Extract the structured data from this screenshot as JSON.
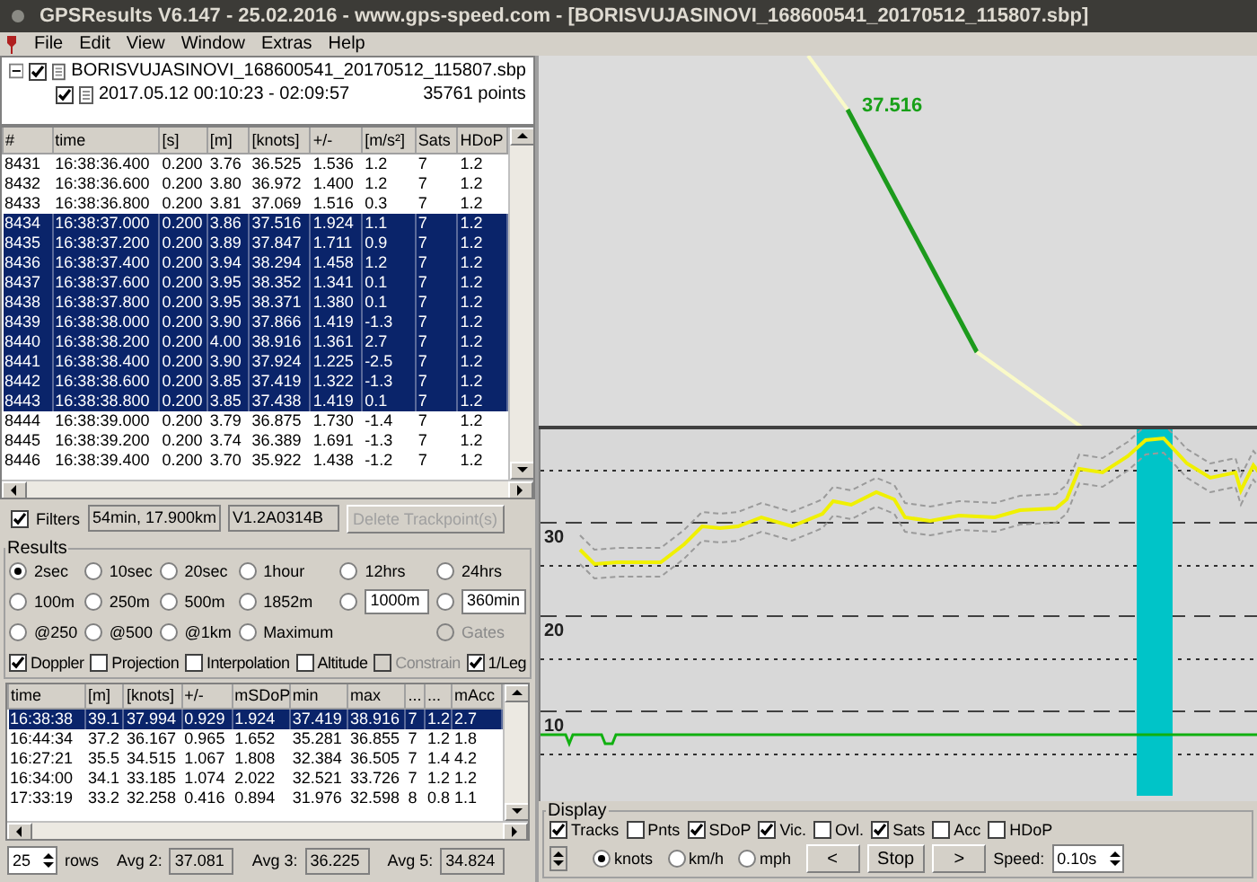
{
  "window": {
    "title": "GPSResults V6.147 - 25.02.2016 - www.gps-speed.com - [BORISVUJASINOVI_168600541_20170512_115807.sbp]"
  },
  "menu": [
    "File",
    "Edit",
    "View",
    "Window",
    "Extras",
    "Help"
  ],
  "tree": {
    "file": {
      "label": "BORISVUJASINOVI_168600541_20170512_115807.sbp",
      "checked": true,
      "expanded": true,
      "children": [
        {
          "label": "2017.05.12 00:10:23 - 02:09:57",
          "points": "35761 points",
          "checked": true
        }
      ]
    }
  },
  "points_table": {
    "columns": [
      "#",
      "time",
      "[s]",
      "[m]",
      "[knots]",
      "+/-",
      "[m/s²]",
      "Sats",
      "HDoP"
    ],
    "rows": [
      {
        "selected": false,
        "cells": [
          "8431",
          "16:38:36.400",
          "0.200",
          "3.76",
          "36.525",
          "1.536",
          "1.2",
          "7",
          "1.2"
        ]
      },
      {
        "selected": false,
        "cells": [
          "8432",
          "16:38:36.600",
          "0.200",
          "3.80",
          "36.972",
          "1.400",
          "1.2",
          "7",
          "1.2"
        ]
      },
      {
        "selected": false,
        "cells": [
          "8433",
          "16:38:36.800",
          "0.200",
          "3.81",
          "37.069",
          "1.516",
          "0.3",
          "7",
          "1.2"
        ]
      },
      {
        "selected": true,
        "cells": [
          "8434",
          "16:38:37.000",
          "0.200",
          "3.86",
          "37.516",
          "1.924",
          "1.1",
          "7",
          "1.2"
        ]
      },
      {
        "selected": true,
        "cells": [
          "8435",
          "16:38:37.200",
          "0.200",
          "3.89",
          "37.847",
          "1.711",
          "0.9",
          "7",
          "1.2"
        ]
      },
      {
        "selected": true,
        "cells": [
          "8436",
          "16:38:37.400",
          "0.200",
          "3.94",
          "38.294",
          "1.458",
          "1.2",
          "7",
          "1.2"
        ]
      },
      {
        "selected": true,
        "cells": [
          "8437",
          "16:38:37.600",
          "0.200",
          "3.95",
          "38.352",
          "1.341",
          "0.1",
          "7",
          "1.2"
        ]
      },
      {
        "selected": true,
        "cells": [
          "8438",
          "16:38:37.800",
          "0.200",
          "3.95",
          "38.371",
          "1.380",
          "0.1",
          "7",
          "1.2"
        ]
      },
      {
        "selected": true,
        "cells": [
          "8439",
          "16:38:38.000",
          "0.200",
          "3.90",
          "37.866",
          "1.419",
          "-1.3",
          "7",
          "1.2"
        ]
      },
      {
        "selected": true,
        "cells": [
          "8440",
          "16:38:38.200",
          "0.200",
          "4.00",
          "38.916",
          "1.361",
          "2.7",
          "7",
          "1.2"
        ]
      },
      {
        "selected": true,
        "cells": [
          "8441",
          "16:38:38.400",
          "0.200",
          "3.90",
          "37.924",
          "1.225",
          "-2.5",
          "7",
          "1.2"
        ]
      },
      {
        "selected": true,
        "cells": [
          "8442",
          "16:38:38.600",
          "0.200",
          "3.85",
          "37.419",
          "1.322",
          "-1.3",
          "7",
          "1.2"
        ]
      },
      {
        "selected": true,
        "cells": [
          "8443",
          "16:38:38.800",
          "0.200",
          "3.85",
          "37.438",
          "1.419",
          "0.1",
          "7",
          "1.2"
        ]
      },
      {
        "selected": false,
        "cells": [
          "8444",
          "16:38:39.000",
          "0.200",
          "3.79",
          "36.875",
          "1.730",
          "-1.4",
          "7",
          "1.2"
        ]
      },
      {
        "selected": false,
        "cells": [
          "8445",
          "16:38:39.200",
          "0.200",
          "3.74",
          "36.389",
          "1.691",
          "-1.3",
          "7",
          "1.2"
        ]
      },
      {
        "selected": false,
        "cells": [
          "8446",
          "16:38:39.400",
          "0.200",
          "3.70",
          "35.922",
          "1.438",
          "-1.2",
          "7",
          "1.2"
        ]
      }
    ]
  },
  "filters": {
    "label": "Filters",
    "checked": true,
    "summary": "54min, 17.900km",
    "version": "V1.2A0314B",
    "delete_button": {
      "label": "Delete Trackpoint(s)",
      "disabled": true
    }
  },
  "results": {
    "title": "Results",
    "options": [
      {
        "kind": "radio",
        "label": "2sec",
        "selected": true,
        "disabled": false
      },
      {
        "kind": "radio",
        "label": "10sec",
        "selected": false,
        "disabled": false
      },
      {
        "kind": "radio",
        "label": "20sec",
        "selected": false,
        "disabled": false
      },
      {
        "kind": "radio",
        "label": "1hour",
        "selected": false,
        "disabled": false
      },
      {
        "kind": "radio",
        "label": "12hrs",
        "selected": false,
        "disabled": false
      },
      {
        "kind": "radio",
        "label": "24hrs",
        "selected": false,
        "disabled": false
      },
      {
        "kind": "radio",
        "label": "100m",
        "selected": false,
        "disabled": false
      },
      {
        "kind": "radio",
        "label": "250m",
        "selected": false,
        "disabled": false
      },
      {
        "kind": "radio",
        "label": "500m",
        "selected": false,
        "disabled": false
      },
      {
        "kind": "radio",
        "label": "1852m",
        "selected": false,
        "disabled": false
      },
      {
        "kind": "radio_field",
        "value": "1000m",
        "selected": false,
        "disabled": false
      },
      {
        "kind": "radio_field",
        "value": "360min",
        "selected": false,
        "disabled": false
      },
      {
        "kind": "radio",
        "label": "@250",
        "selected": false,
        "disabled": false
      },
      {
        "kind": "radio",
        "label": "@500",
        "selected": false,
        "disabled": false
      },
      {
        "kind": "radio",
        "label": "@1km",
        "selected": false,
        "disabled": false
      },
      {
        "kind": "radio",
        "label": "Maximum",
        "selected": false,
        "disabled": false
      },
      {
        "kind": "spacer"
      },
      {
        "kind": "radio",
        "label": "Gates",
        "selected": false,
        "disabled": true
      }
    ],
    "checks": [
      {
        "label": "Doppler",
        "checked": true,
        "disabled": false
      },
      {
        "label": "Projection",
        "checked": false,
        "disabled": false
      },
      {
        "label": "Interpolation",
        "checked": false,
        "disabled": false
      },
      {
        "label": "Altitude",
        "checked": false,
        "disabled": false
      },
      {
        "label": "Constrain",
        "checked": false,
        "disabled": true
      },
      {
        "label": "1/Leg",
        "checked": true,
        "disabled": false
      }
    ]
  },
  "results_table": {
    "columns": [
      "time",
      "[m]",
      "[knots]",
      "+/-",
      "mSDoP",
      "min",
      "max",
      "...",
      "...",
      "mAcc"
    ],
    "rows": [
      {
        "selected": true,
        "cells": [
          "16:38:38",
          "39.1",
          "37.994",
          "0.929",
          "1.924",
          "37.419",
          "38.916",
          "7",
          "1.2",
          "2.7"
        ]
      },
      {
        "selected": false,
        "cells": [
          "16:44:34",
          "37.2",
          "36.167",
          "0.965",
          "1.652",
          "35.281",
          "36.855",
          "7",
          "1.2",
          "1.8"
        ]
      },
      {
        "selected": false,
        "cells": [
          "16:27:21",
          "35.5",
          "34.515",
          "1.067",
          "1.808",
          "32.384",
          "36.505",
          "7",
          "1.4",
          "4.2"
        ]
      },
      {
        "selected": false,
        "cells": [
          "16:34:00",
          "34.1",
          "33.185",
          "1.074",
          "2.022",
          "32.521",
          "33.726",
          "7",
          "1.2",
          "1.2"
        ]
      },
      {
        "selected": false,
        "cells": [
          "17:33:19",
          "33.2",
          "32.258",
          "0.416",
          "0.894",
          "31.976",
          "32.598",
          "8",
          "0.8",
          "1.1"
        ]
      }
    ]
  },
  "footer": {
    "rows_value": "25",
    "rows_label": "rows",
    "averages": [
      {
        "label": "Avg 2:",
        "value": "37.081"
      },
      {
        "label": "Avg 3:",
        "value": "36.225"
      },
      {
        "label": "Avg 5:",
        "value": "34.824"
      }
    ]
  },
  "map": {
    "speed_label": "37.516"
  },
  "speed_graph": {
    "y_labels": [
      "30",
      "20",
      "10"
    ]
  },
  "display": {
    "title": "Display",
    "checks": [
      {
        "label": "Tracks",
        "checked": true
      },
      {
        "label": "Pnts",
        "checked": false
      },
      {
        "label": "SDoP",
        "checked": true
      },
      {
        "label": "Vic.",
        "checked": true
      },
      {
        "label": "Ovl.",
        "checked": false
      },
      {
        "label": "Sats",
        "checked": true
      },
      {
        "label": "Acc",
        "checked": false
      },
      {
        "label": "HDoP",
        "checked": false
      }
    ],
    "units": [
      {
        "label": "knots",
        "selected": true
      },
      {
        "label": "km/h",
        "selected": false
      },
      {
        "label": "mph",
        "selected": false
      }
    ],
    "buttons": [
      "<",
      "Stop",
      ">"
    ],
    "speed_label": "Speed:",
    "speed_value": "0.10s"
  }
}
